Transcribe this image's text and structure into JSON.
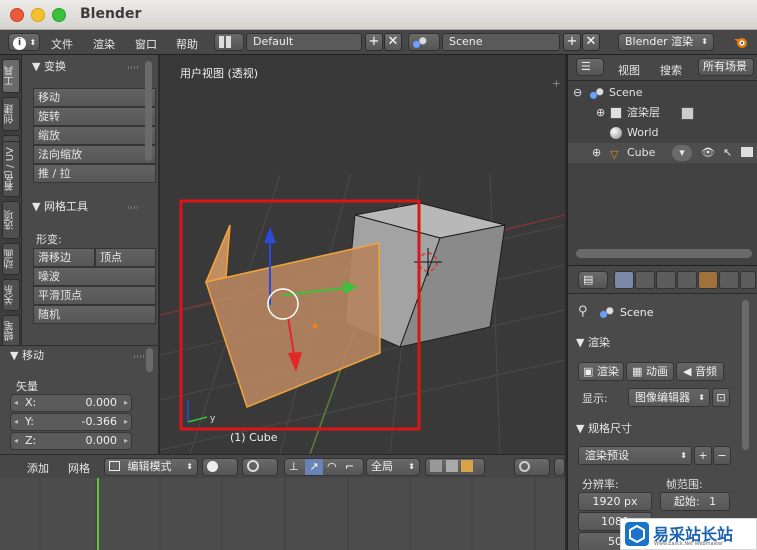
{
  "window": {
    "title": "Blender"
  },
  "topbar": {
    "menus": [
      "文件",
      "渲染",
      "窗口",
      "帮助"
    ],
    "screen_layout": "Default",
    "scene": "Scene",
    "engine": "Blender 渲染"
  },
  "toolshelf": {
    "tabs": [
      "工具",
      "创建",
      "关系",
      "动画",
      "物理",
      "着色 / UV",
      "选项",
      "蜡笔"
    ],
    "transform_header": "变换",
    "transform_buttons": [
      "移动",
      "旋转",
      "缩放",
      "法向缩放",
      "推 / 拉"
    ],
    "mesh_header": "网格工具",
    "deform_label": "形变:",
    "slide_edge": "滑移边",
    "vertex": "顶点",
    "deform_buttons": [
      "噪波",
      "平滑顶点",
      "随机"
    ]
  },
  "redo_panel": {
    "header": "移动",
    "vector_label": "矢量",
    "fields": [
      {
        "label": "X:",
        "value": "0.000"
      },
      {
        "label": "Y:",
        "value": "-0.366"
      },
      {
        "label": "Z:",
        "value": "0.000"
      }
    ]
  },
  "viewport": {
    "view_label": "用户视图 (透视)",
    "object_label": "(1) Cube",
    "accent": "#e8a25a",
    "selection_box_color": "#d9141b"
  },
  "viewport_header": {
    "view": "添加",
    "mesh": "网格",
    "mode": "编辑模式",
    "orientation": "全局"
  },
  "outliner": {
    "view": "视图",
    "search": "搜索",
    "filter": "所有场景",
    "items": [
      {
        "label": "Scene"
      },
      {
        "label": "渲染层"
      },
      {
        "label": "World"
      },
      {
        "label": "Cube"
      }
    ]
  },
  "properties": {
    "scene_name": "Scene",
    "render_section": "渲染",
    "render_btn": "渲染",
    "anim_btn": "动画",
    "audio_btn": "音频",
    "display_label": "显示:",
    "display_value": "图像编辑器",
    "dimensions_section": "规格尺寸",
    "preset": "渲染预设",
    "resolution_label": "分辨率:",
    "res_x": "1920 px",
    "res_y": "1080",
    "res_pct": "50",
    "frame_range_label": "帧范围:",
    "start_label": "起始:",
    "start_value": "1"
  },
  "watermark": {
    "brand": "易采站长站",
    "url": "Www.Easck.Net Webmaster"
  }
}
